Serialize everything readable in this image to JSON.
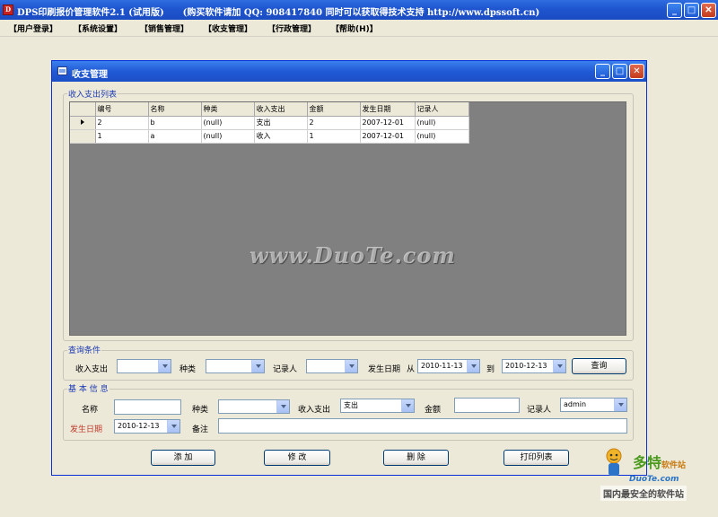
{
  "app": {
    "title": "DPS印刷报价管理软件2.1 (试用版)      (购买软件请加 QQ: 908417840 同时可以获取得技术支持 http://www.dpssoft.cn)",
    "icon_label": "D"
  },
  "menu": [
    "【用户登录】",
    "【系统设置】",
    "【销售管理】",
    "【收支管理】",
    "【行政管理】",
    "【帮助(H)】"
  ],
  "window": {
    "title": "收支管理"
  },
  "list_section": {
    "legend": "收入支出列表",
    "columns": [
      "编号",
      "名称",
      "种类",
      "收入支出",
      "金额",
      "发生日期",
      "记录人"
    ],
    "rows": [
      [
        "2",
        "b",
        "(null)",
        "支出",
        "2",
        "2007-12-01",
        "(null)"
      ],
      [
        "1",
        "a",
        "(null)",
        "收入",
        "1",
        "2007-12-01",
        "(null)"
      ]
    ],
    "current_row_index": 0
  },
  "query_section": {
    "legend": "查询条件",
    "income_expense_label": "收入支出",
    "income_expense_value": "",
    "category_label": "种类",
    "category_value": "",
    "recorder_label": "记录人",
    "recorder_value": "",
    "date_label": "发生日期",
    "from_label": "从",
    "from_date": "2010-11-13",
    "to_label": "到",
    "to_date": "2010-12-13",
    "query_button": "查询"
  },
  "info_section": {
    "legend": "基 本 信 息",
    "name_label": "名称",
    "name_value": "",
    "category_label": "种类",
    "category_value": "",
    "income_expense_label": "收入支出",
    "income_expense_value": "支出",
    "amount_label": "金额",
    "amount_value": "",
    "recorder_label": "记录人",
    "recorder_value": "admin",
    "date_label": "发生日期",
    "date_value": "2010-12-13",
    "remark_label": "备注",
    "remark_value": ""
  },
  "buttons": {
    "add": "添 加",
    "edit": "修 改",
    "delete": "删 除",
    "print": "打印列表"
  },
  "watermark": "www.DuoTe.com",
  "logo": {
    "main": "多特",
    "main_small": "软件站",
    "sub": "DuoTe.com",
    "tag": "国内最安全的软件站"
  },
  "colors": {
    "titlebar": "#215ad6",
    "legend_text": "#1c3ab5",
    "date_label_red": "#c0392b",
    "grid_background": "#808080"
  }
}
